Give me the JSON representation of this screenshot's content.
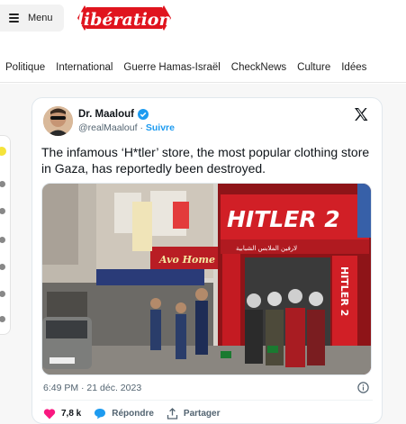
{
  "header": {
    "menu_label": "Menu",
    "logo_text": "libération"
  },
  "nav": {
    "items": [
      "Politique",
      "International",
      "Guerre Hamas-Israël",
      "CheckNews",
      "Culture",
      "Idées"
    ]
  },
  "tweet": {
    "author_name": "Dr. Maalouf",
    "author_handle": "@realMaalouf",
    "separator": "·",
    "follow_label": "Suivre",
    "text": "The infamous ‘H*tler’ store, the most popular clothing store in Gaza, has reportedly been destroyed.",
    "timestamp": "6:49 PM · 21 déc. 2023",
    "likes": "7,8 k",
    "reply_label": "Répondre",
    "share_label": "Partager",
    "photo": {
      "sign_main": "HITLER 2",
      "sign_arabic": "لارفين الملابس الشبابية",
      "vertical_sign": "HITLER 2",
      "left_sign": "Avo Home"
    }
  },
  "colors": {
    "logo_red": "#e0141e",
    "link_blue": "#1d9bf0",
    "like_red": "#f91880"
  }
}
